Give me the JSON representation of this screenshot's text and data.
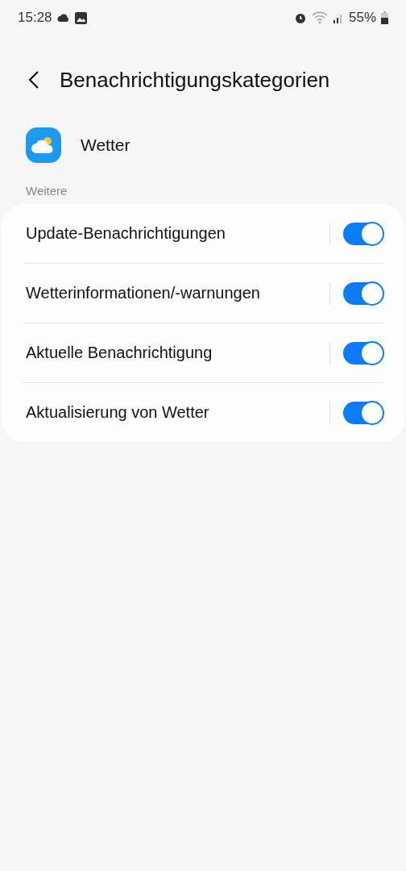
{
  "status_bar": {
    "time": "15:28",
    "battery": "55%"
  },
  "header": {
    "title": "Benachrichtigungskategorien"
  },
  "app": {
    "name": "Wetter"
  },
  "section": {
    "label": "Weitere"
  },
  "items": [
    {
      "label": "Update-Benachrichtigungen",
      "on": true
    },
    {
      "label": "Wetterinformationen/-warnungen",
      "on": true
    },
    {
      "label": "Aktuelle Benachrichtigung",
      "on": true
    },
    {
      "label": "Aktualisierung von Wetter",
      "on": true
    }
  ]
}
